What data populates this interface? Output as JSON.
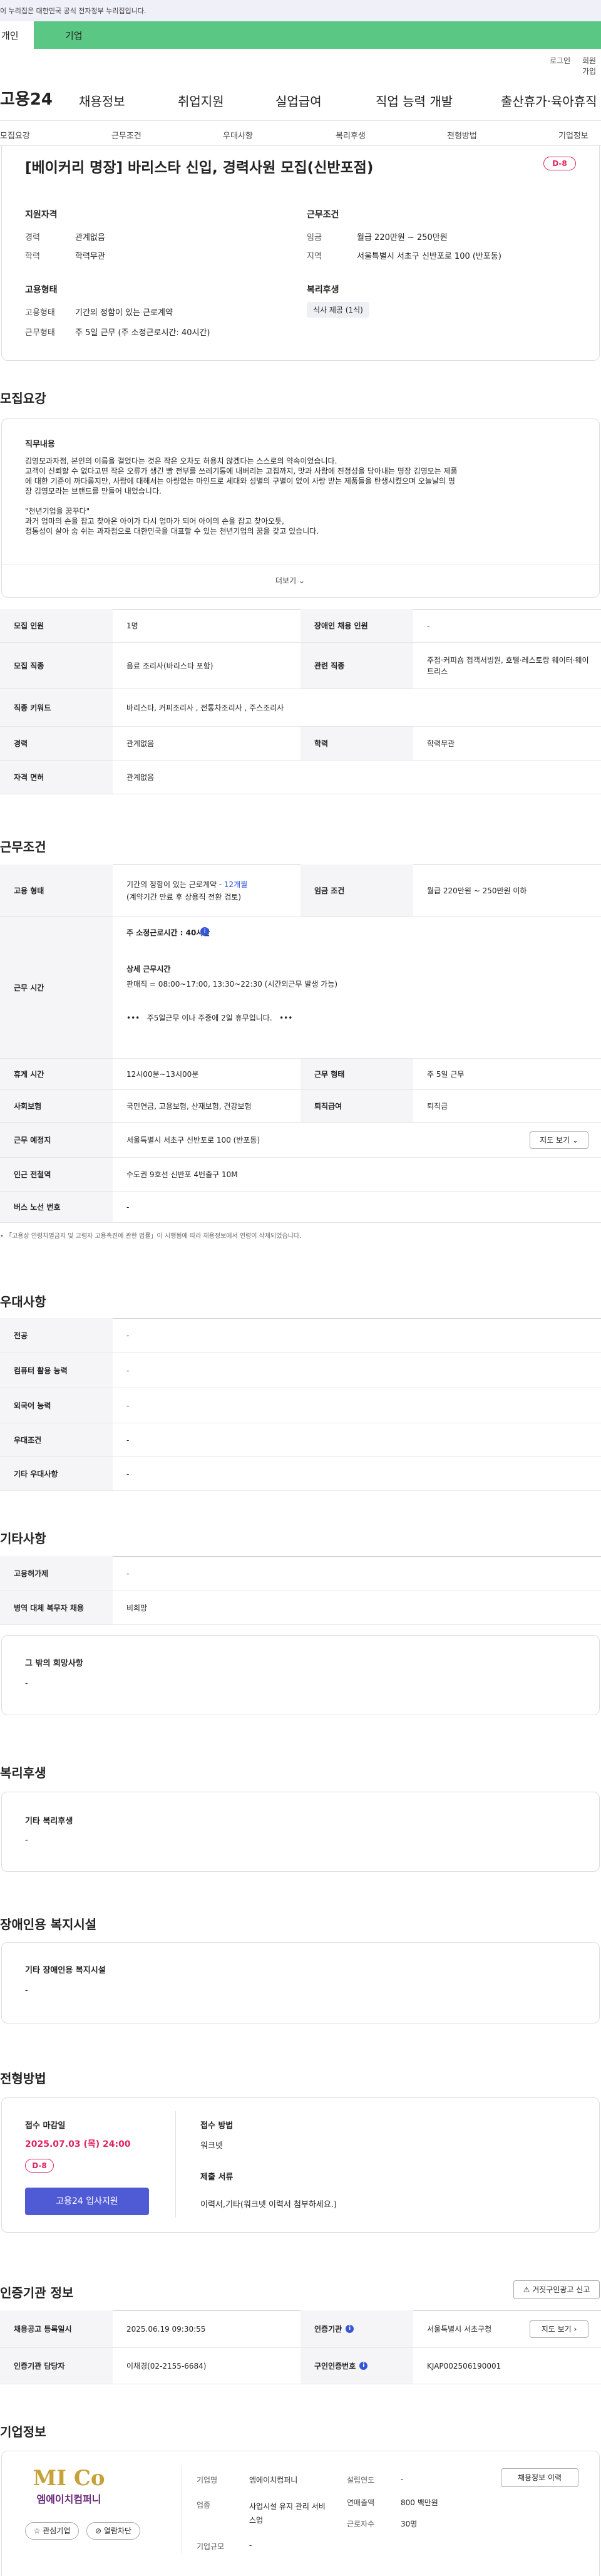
{
  "gov_banner": "이 누리집은 대한민국 공식 전자정부 누리집입니다.",
  "top_tabs": [
    "개인",
    "기업"
  ],
  "util": [
    "로그인",
    "회원가입"
  ],
  "logo": "고용24",
  "gnb": [
    "채용정보",
    "취업지원",
    "실업급여",
    "직업 능력 개발",
    "출산휴가·육아휴직"
  ],
  "subnav": [
    "모집요강",
    "근무조건",
    "우대사항",
    "복리후생",
    "전형방법",
    "기업정보"
  ],
  "job": {
    "title": "[베이커리 명장] 바리스타 신입, 경력사원 모집(신반포점)",
    "dday": "D-8",
    "qual_title": "지원자격",
    "qual": [
      [
        "경력",
        "관계없음"
      ],
      [
        "학력",
        "학력무관"
      ]
    ],
    "cond_title": "근무조건",
    "cond": [
      [
        "임금",
        "월급 220만원 ~ 250만원"
      ],
      [
        "지역",
        "서울특별시 서초구 신반포로 100 (반포동)"
      ]
    ],
    "emp_title": "고용형태",
    "emp": [
      [
        "고용형태",
        "기간의 정함이 있는 근로계약"
      ],
      [
        "근무형태",
        "주 5일 근무 (주 소정근로시간: 40시간)"
      ]
    ],
    "welfare_title": "복리후생",
    "welfare_tag": "식사 제공 (1식)"
  },
  "recruit": {
    "section": "모집요강",
    "duty_title": "직무내용",
    "duty_lines": [
      "김영모과자점, 본인의 이름을 걸었다는 것은 작은 오차도 허용치 않겠다는 스스로의 약속이었습니다.",
      "고객이 신뢰할 수 없다고면 작은 오류가 생긴 빵 전부를 쓰레기통에 내버리는 고집까지, 맛과 사람에 진정성을 담아내는 명장 김영모는 제품",
      "에 대한 기준이 까다롭지만, 사람에 대해서는 아량없는 마인드로 세대와 성별의 구별이 없이 사랑 받는 제품들을 탄생시켰으며 오늘날의 명",
      "장 김영모라는 브랜드를 만들어 내었습니다.",
      "",
      "\"천년기업을 꿈꾸다\"",
      "과거 엄마의 손을 잡고 찾아온 아이가 다시 엄마가 되어 아이의 손을 잡고 찾아오듯,",
      "정통성이 살아 숨 쉬는 과자점으로 대한민국을 대표할 수 있는 천년기업의 꿈을 갖고 있습니다."
    ],
    "more": "더보기",
    "table": [
      {
        "h1": "모집 인원",
        "v1": "1명",
        "h2": "장애인 채용 인원",
        "v2": "-"
      },
      {
        "h1": "모집 직종",
        "v1": "음료 조리사(바리스타 포함)",
        "h2": "관련 직종",
        "v2": "주점·커피숍 접객서빙원, 호텔·레스토랑 웨이터·웨이트리스"
      },
      {
        "h1": "직종 키워드",
        "v1": "바리스타, 커피조리사 , 전통차조리사 , 주스조리사",
        "h2": "",
        "v2": ""
      },
      {
        "h1": "경력",
        "v1": "관계없음",
        "h2": "학력",
        "v2": "학력무관"
      },
      {
        "h1": "자격 면허",
        "v1": "관계없음",
        "h2": "",
        "v2": ""
      }
    ]
  },
  "work": {
    "section": "근무조건",
    "emp_h": "고용 형태",
    "emp_v1": "기간의 정함이 있는 근로계약 - ",
    "emp_months": "12개월",
    "emp_v2": "(계약기간 만료 후 상용직 전환 검토)",
    "wage_h": "임금 조건",
    "wage_v": "월급 220만원 ~ 250만원 이하",
    "time_h": "근무 시간",
    "time_week": "주 소정근로시간 : 40시간",
    "time_detail_title": "상세 근무시간",
    "time_detail": "판매직 =  08:00~17:00, 13:30~22:30   (시간외근무 발생 가능)",
    "time_note": "주5일근무 이나   주중에 2일 휴무입니다.",
    "break_h": "휴게 시간",
    "break_v": "12시00분~13시00분",
    "form_h": "근무 형태",
    "form_v": "주 5일 근무",
    "ins_h": "사회보험",
    "ins_v": "국민연금, 고용보험, 산재보험, 건강보험",
    "ret_h": "퇴직급여",
    "ret_v": "퇴직금",
    "place_h": "근무 예정지",
    "place_v": "서울특별시 서초구 신반포로 100 (반포동)",
    "map_btn": "지도 보기",
    "subway_h": "인근 전철역",
    "subway_v": "수도권 9호선 신반포 4번출구 10M",
    "bus_h": "버스 노선 번호",
    "bus_v": "-",
    "footnote": "「고용상 연령차별금지 및 고령자 고용촉진에 관한 법률」이 시행됨에 따라 채용정보에서 연령이 삭제되었습니다."
  },
  "pref": {
    "section": "우대사항",
    "rows": [
      [
        "전공",
        "-"
      ],
      [
        "컴퓨터 활용 능력",
        "-"
      ],
      [
        "외국어 능력",
        "-"
      ],
      [
        "우대조건",
        "-"
      ],
      [
        "기타 우대사항",
        "-"
      ]
    ]
  },
  "etc": {
    "section": "기타사항",
    "rows": [
      [
        "고용허가제",
        "-"
      ],
      [
        "병역 대체 복무자 채용",
        "비희망"
      ]
    ],
    "box_title": "그 밖의 희망사항",
    "box_val": "-"
  },
  "benefit": {
    "section": "복리후생",
    "box_title": "기타 복리후생",
    "box_val": "-"
  },
  "disab": {
    "section": "장애인용 복지시설",
    "box_title": "기타 장애인용 복지시설",
    "box_val": "-"
  },
  "process": {
    "section": "전형방법",
    "deadline_title": "접수 마감일",
    "deadline": "2025.07.03 (목) 24:00",
    "dday": "D-8",
    "apply_btn": "고용24 입사지원",
    "method_title": "접수 방법",
    "method": "워크넷",
    "docs_title": "제출 서류",
    "docs": "이력서,기타(워크넷 이력서 첨부하세요.)"
  },
  "cert": {
    "section": "인증기관 정보",
    "report_btn": "거짓구인광고 신고",
    "rows": [
      {
        "h1": "채용공고 등록일시",
        "v1": "2025.06.19 09:30:55",
        "h2": "인증기관",
        "v2": "서울특별시 서초구청",
        "btn": "지도 보기"
      },
      {
        "h1": "인증기관 담당자",
        "v1": "이채경(02-2155-6684)",
        "h2": "구인인증번호",
        "v2": "KJAP002506190001",
        "btn": ""
      }
    ]
  },
  "company": {
    "section": "기업정보",
    "logo_text": "MI Co",
    "logo_sub": "엠에이치컴퍼니",
    "fav_btn": "관심기업",
    "view_btn": "열람차단",
    "name_h": "기업명",
    "name_v": "엠에이치컴퍼니",
    "ind_h": "업종",
    "ind_v": "사업시설 유지 관리 서비스업",
    "size_h": "기업규모",
    "size_v": "-",
    "est_h": "설립연도",
    "est_v": "-",
    "sales_h": "연매출액",
    "sales_v": "800 백만원",
    "staff_h": "근로자수",
    "staff_v": "30명",
    "jobs_btn": "채용정보 이력"
  }
}
